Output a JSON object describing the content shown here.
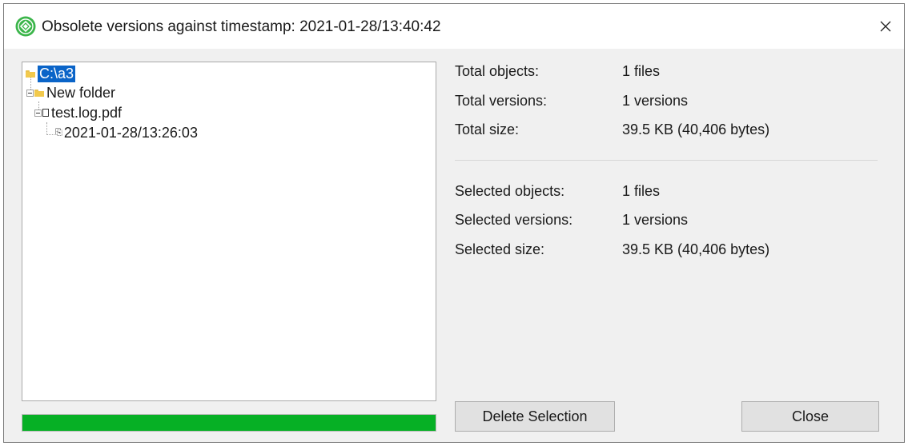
{
  "window": {
    "title": "Obsolete versions against timestamp: 2021-01-28/13:40:42",
    "brand_color": "#3bb54a"
  },
  "tree": {
    "root": {
      "label": "C:\\a3",
      "icon": "folder-icon",
      "selected": true
    },
    "folder": {
      "label": "New folder",
      "icon": "folder-icon"
    },
    "file": {
      "label": "test.log.pdf",
      "icon": "file-icon"
    },
    "version": {
      "label": "2021-01-28/13:26:03",
      "icon": "version-icon"
    }
  },
  "totals": {
    "objects_label": "Total objects:",
    "objects_value": "1 files",
    "versions_label": "Total versions:",
    "versions_value": "1 versions",
    "size_label": "Total size:",
    "size_value": "39.5 KB (40,406 bytes)"
  },
  "selection": {
    "objects_label": "Selected objects:",
    "objects_value": "1 files",
    "versions_label": "Selected versions:",
    "versions_value": "1 versions",
    "size_label": "Selected size:",
    "size_value": "39.5 KB (40,406 bytes)"
  },
  "progress": {
    "fraction": 1.0,
    "color": "#06b025"
  },
  "buttons": {
    "delete_label": "Delete Selection",
    "close_label": "Close"
  }
}
